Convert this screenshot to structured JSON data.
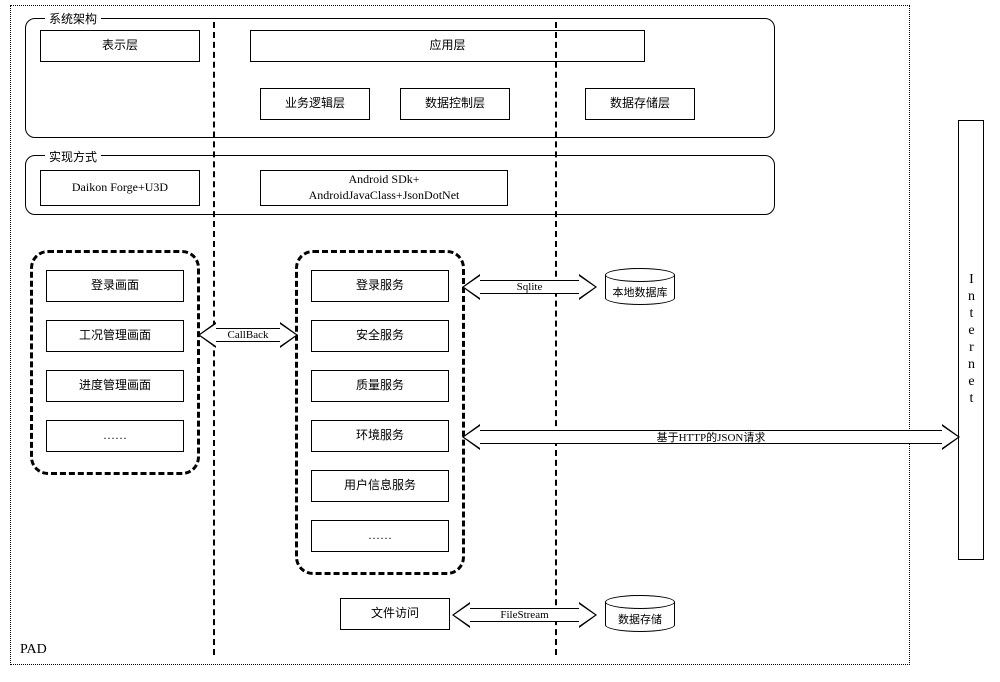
{
  "pad_label": "PAD",
  "sections": {
    "arch": {
      "title": "系统架构",
      "row1": {
        "presentation": "表示层",
        "application": "应用层"
      },
      "row2": {
        "business": "业务逻辑层",
        "data_ctrl": "数据控制层",
        "data_store": "数据存储层"
      }
    },
    "impl": {
      "title": "实现方式",
      "left": "Daikon Forge+U3D",
      "right": "Android SDk+\nAndroidJavaClass+JsonDotNet"
    }
  },
  "screens": {
    "items": [
      "登录画面",
      "工况管理画面",
      "进度管理画面",
      "……"
    ]
  },
  "services": {
    "items": [
      "登录服务",
      "安全服务",
      "质量服务",
      "环境服务",
      "用户信息服务",
      "……"
    ]
  },
  "arrows": {
    "callback": "CallBack",
    "sqlite": "Sqlite",
    "http_json": "基于HTTP的JSON请求",
    "filestream": "FileStream"
  },
  "db": {
    "local": "本地数据库",
    "storage": "数据存储"
  },
  "file_access": "文件访问",
  "internet": "Internet"
}
